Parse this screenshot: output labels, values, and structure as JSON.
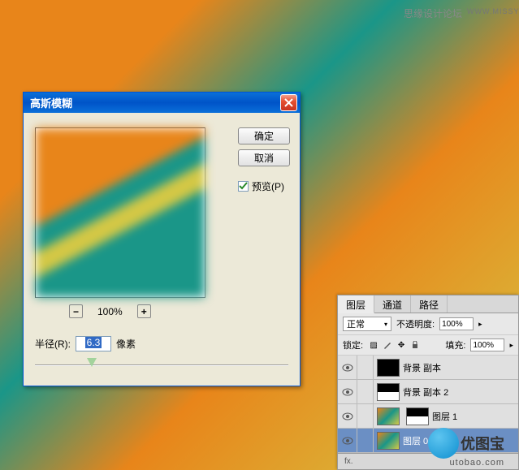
{
  "watermarks": {
    "top": "思缘设计论坛",
    "topUrl": "WWW.MISSYUAN.COM",
    "logoText": "优图宝",
    "logoUrl": "utobao.com"
  },
  "dialog": {
    "title": "高斯模糊",
    "ok": "确定",
    "cancel": "取消",
    "previewCb": "预览(P)",
    "previewChecked": true,
    "zoom": "100%",
    "radiusLabel": "半径(R):",
    "radiusValue": "6.3",
    "radiusUnit": "像素"
  },
  "layersPanel": {
    "tabs": [
      "图层",
      "通道",
      "路径"
    ],
    "blendMode": "正常",
    "opacityLabel": "不透明度:",
    "opacity": "100%",
    "lockLabel": "锁定:",
    "fillLabel": "填充:",
    "fill": "100%",
    "layers": [
      {
        "name": "背景 副本"
      },
      {
        "name": "背景 副本 2"
      },
      {
        "name": "图层 1"
      },
      {
        "name": "图层 0"
      }
    ],
    "footIcon": "fx."
  }
}
